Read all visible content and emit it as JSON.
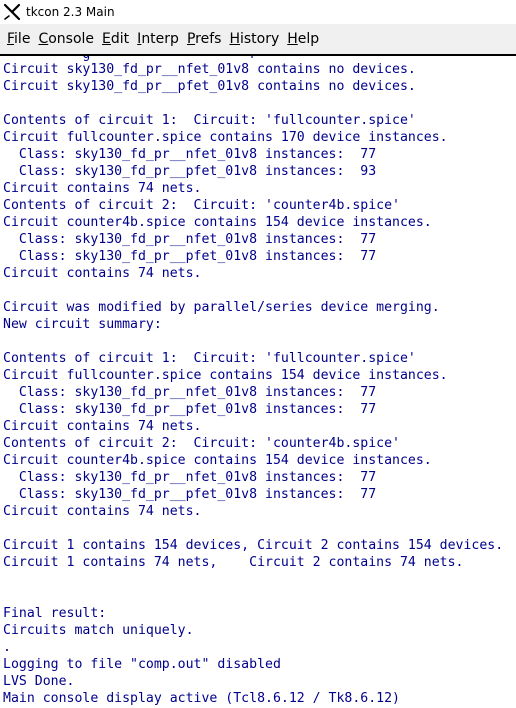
{
  "window": {
    "title": "tkcon 2.3 Main",
    "icon": "tk-feather-x-icon"
  },
  "menu": [
    {
      "mnemonic": "F",
      "rest": "ile"
    },
    {
      "mnemonic": "C",
      "rest": "onsole"
    },
    {
      "mnemonic": "E",
      "rest": "dit"
    },
    {
      "mnemonic": "I",
      "rest": "nterp"
    },
    {
      "mnemonic": "P",
      "rest": "refs"
    },
    {
      "mnemonic": "H",
      "rest": "istory"
    },
    {
      "mnemonic": "H",
      "rest": "elp"
    }
  ],
  "colors": {
    "output_text": "#00008b",
    "menubar_bg": "#f0f0f0"
  },
  "console": {
    "cut_line": "          g                    r",
    "lines": [
      "Circuit sky130_fd_pr__nfet_01v8 contains no devices.",
      "Circuit sky130_fd_pr__pfet_01v8 contains no devices.",
      "",
      "Contents of circuit 1:  Circuit: 'fullcounter.spice'",
      "Circuit fullcounter.spice contains 170 device instances.",
      "  Class: sky130_fd_pr__nfet_01v8 instances:  77",
      "  Class: sky130_fd_pr__pfet_01v8 instances:  93",
      "Circuit contains 74 nets.",
      "Contents of circuit 2:  Circuit: 'counter4b.spice'",
      "Circuit counter4b.spice contains 154 device instances.",
      "  Class: sky130_fd_pr__nfet_01v8 instances:  77",
      "  Class: sky130_fd_pr__pfet_01v8 instances:  77",
      "Circuit contains 74 nets.",
      "",
      "Circuit was modified by parallel/series device merging.",
      "New circuit summary:",
      "",
      "Contents of circuit 1:  Circuit: 'fullcounter.spice'",
      "Circuit fullcounter.spice contains 154 device instances.",
      "  Class: sky130_fd_pr__nfet_01v8 instances:  77",
      "  Class: sky130_fd_pr__pfet_01v8 instances:  77",
      "Circuit contains 74 nets.",
      "Contents of circuit 2:  Circuit: 'counter4b.spice'",
      "Circuit counter4b.spice contains 154 device instances.",
      "  Class: sky130_fd_pr__nfet_01v8 instances:  77",
      "  Class: sky130_fd_pr__pfet_01v8 instances:  77",
      "Circuit contains 74 nets.",
      "",
      "Circuit 1 contains 154 devices, Circuit 2 contains 154 devices.",
      "Circuit 1 contains 74 nets,    Circuit 2 contains 74 nets.",
      "",
      "",
      "Final result:",
      "Circuits match uniquely.",
      ".",
      "Logging to file \"comp.out\" disabled",
      "LVS Done.",
      "Main console display active (Tcl8.6.12 / Tk8.6.12)"
    ]
  }
}
